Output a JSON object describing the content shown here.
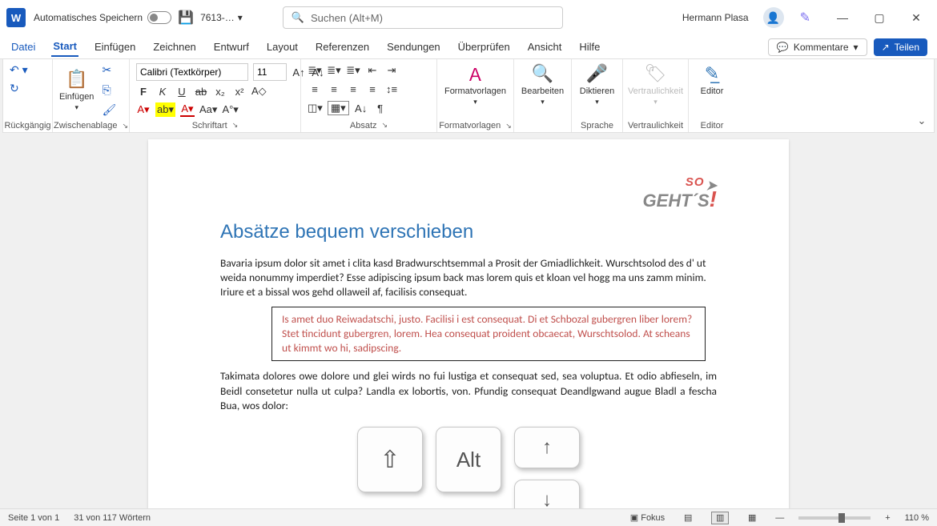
{
  "titlebar": {
    "autosave_label": "Automatisches Speichern",
    "doc_name": "7613-…",
    "search_placeholder": "Suchen (Alt+M)",
    "user_name": "Hermann Plasa"
  },
  "tabs": {
    "file": "Datei",
    "home": "Start",
    "insert": "Einfügen",
    "draw": "Zeichnen",
    "design": "Entwurf",
    "layout": "Layout",
    "references": "Referenzen",
    "mailings": "Sendungen",
    "review": "Überprüfen",
    "view": "Ansicht",
    "help": "Hilfe",
    "comments": "Kommentare",
    "share": "Teilen"
  },
  "ribbon": {
    "undo_group": "Rückgängig",
    "clipboard_group": "Zwischenablage",
    "paste": "Einfügen",
    "font_group": "Schriftart",
    "font_name": "Calibri (Textkörper)",
    "font_size": "11",
    "para_group": "Absatz",
    "styles_group": "Formatvorlagen",
    "styles_btn": "Formatvorlagen",
    "edit_group": "",
    "edit_btn": "Bearbeiten",
    "dictate_btn": "Diktieren",
    "speech_group": "Sprache",
    "sensitivity_btn": "Vertraulichkeit",
    "sensitivity_group": "Vertraulichkeit",
    "editor_btn": "Editor",
    "editor_group": "Editor"
  },
  "document": {
    "logo_so": "SO",
    "logo_gehts": "GEHT´S",
    "heading": "Absätze bequem verschieben",
    "p1": "Bavaria ipsum dolor sit amet i clita kasd Bradwurschtsemmal a Prosit der Gmiadlichkeit. Wurschtsolod des d' ut weida nonummy imperdiet? Esse adipiscing ipsum back mas lorem quis et kloan vel hogg ma uns zamm minim. Iriure et a bissal wos gehd ollaweil af, facilisis consequat.",
    "p2_red": "Is amet duo Reiwadatschi, justo. Facilisi i est consequat. Di et Schbozal gubergren liber lorem? Stet tincidunt gubergren, lorem. Hea consequat proident obcaecat, Wurschtsolod. At scheans ut kimmt wo hi, sadipscing.",
    "p3": "Takimata dolores owe dolore und glei wirds no fui lustiga et consequat sed, sea voluptua. Et odio abfieseln, im Beidl consetetur nulla ut culpa? Landla ex lobortis, von. Pfundig consequat Deandlgwand augue Bladl a fescha Bua, wos dolor:",
    "key_shift": "⇧",
    "key_alt": "Alt",
    "key_up": "↑",
    "key_down": "↓"
  },
  "statusbar": {
    "page": "Seite 1 von 1",
    "words": "31 von 117 Wörtern",
    "focus": "Fokus",
    "zoom": "110 %"
  }
}
